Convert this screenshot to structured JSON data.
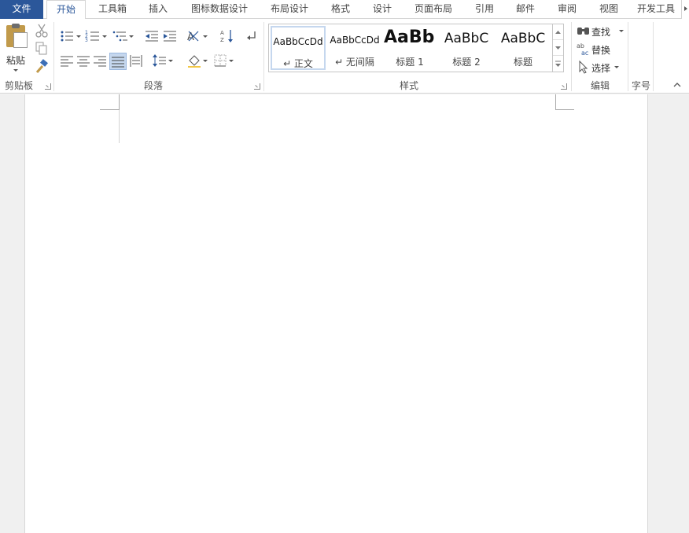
{
  "tabs": [
    {
      "label": "文件"
    },
    {
      "label": "开始"
    },
    {
      "label": "工具箱"
    },
    {
      "label": "插入"
    },
    {
      "label": "图标数据设计"
    },
    {
      "label": "布局设计"
    },
    {
      "label": "格式"
    },
    {
      "label": "设计"
    },
    {
      "label": "页面布局"
    },
    {
      "label": "引用"
    },
    {
      "label": "邮件"
    },
    {
      "label": "审阅"
    },
    {
      "label": "视图"
    },
    {
      "label": "开发工具"
    }
  ],
  "clipboard": {
    "paste_label": "粘贴",
    "group_label": "剪贴板"
  },
  "paragraph": {
    "group_label": "段落"
  },
  "styles": {
    "group_label": "样式",
    "items": [
      {
        "sample": "AaBbCcDd",
        "name": "↵ 正文"
      },
      {
        "sample": "AaBbCcDd",
        "name": "↵ 无间隔"
      },
      {
        "sample": "AaBbl",
        "name": "标题 1"
      },
      {
        "sample": "AaBbC",
        "name": "标题 2"
      },
      {
        "sample": "AaBbC",
        "name": "标题"
      }
    ]
  },
  "editing": {
    "find_label": "查找",
    "replace_label": "替换",
    "select_label": "选择",
    "group_label": "编辑"
  },
  "font_size": {
    "group_label": "字号"
  },
  "colors": {
    "file_tab": "#2b579a",
    "active_tab_text": "#2b579a",
    "selected_style_border": "#c5d7ee",
    "justify_highlight": "#c5d7ee"
  }
}
